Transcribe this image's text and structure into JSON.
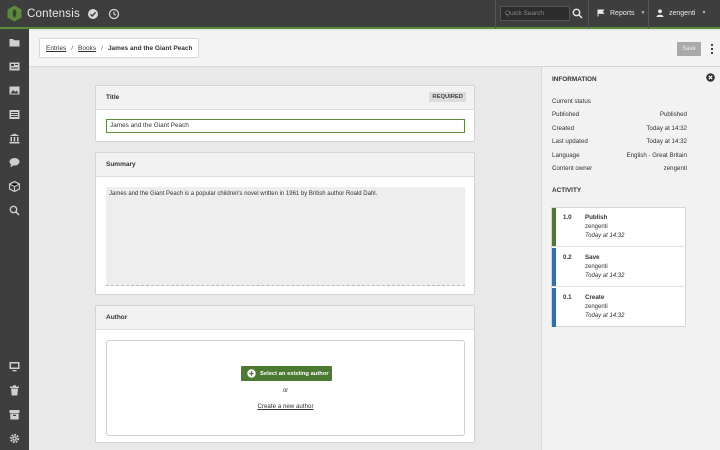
{
  "header": {
    "app_name": "Contensis",
    "search_placeholder": "Quick Search",
    "reports_label": "Reports",
    "user_label": "zengenti"
  },
  "breadcrumb": {
    "items": [
      "Entries",
      "Books"
    ],
    "current": "James and the Giant Peach"
  },
  "toolbar": {
    "save_label": "Save"
  },
  "fields": {
    "title": {
      "label": "Title",
      "badge": "REQUIRED",
      "value": "James and the Giant Peach"
    },
    "summary": {
      "label": "Summary",
      "value": "James and the Giant Peach is a popular children's novel written in 1961 by British author Roald Dahl."
    },
    "author": {
      "label": "Author",
      "select_button": "Select an existing author",
      "or_text": "or",
      "create_link": "Create a new author"
    }
  },
  "information": {
    "heading": "INFORMATION",
    "current_status_label": "Current status",
    "rows": [
      {
        "label": "Published",
        "value": "Published"
      },
      {
        "label": "Created",
        "value": "Today at 14:32"
      },
      {
        "label": "Last updated",
        "value": "Today at 14:32"
      },
      {
        "label": "Language",
        "value": "English - Great Britain"
      },
      {
        "label": "Content owner",
        "value": "zengenti"
      }
    ]
  },
  "activity": {
    "heading": "ACTIVITY",
    "items": [
      {
        "version": "1.0",
        "action": "Publish",
        "user": "zengenti",
        "time": "Today at 14:32",
        "color": "#4d7a32"
      },
      {
        "version": "0.2",
        "action": "Save",
        "user": "zengenti",
        "time": "Today at 14:32",
        "color": "#2f6fb2"
      },
      {
        "version": "0.1",
        "action": "Create",
        "user": "zengenti",
        "time": "Today at 14:32",
        "color": "#2f6fb2"
      }
    ]
  },
  "colors": {
    "accent": "#5a8a3a",
    "topbar": "#3e3e3e",
    "save_disabled": "#a9a9a9"
  },
  "sidebar_icons": [
    "folder-icon",
    "newspaper-icon",
    "image-icon",
    "list-icon",
    "building-icon",
    "chat-icon",
    "box-icon",
    "search-icon",
    "monitor-icon",
    "trash-icon",
    "archive-icon",
    "settings-icon"
  ]
}
